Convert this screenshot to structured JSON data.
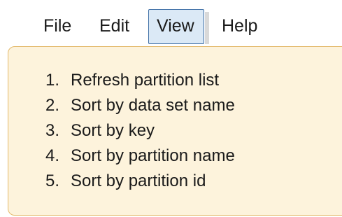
{
  "menubar": {
    "items": [
      {
        "label": "File"
      },
      {
        "label": "Edit"
      },
      {
        "label": "View",
        "active": true
      },
      {
        "label": "Help"
      }
    ]
  },
  "view_menu": {
    "options": [
      {
        "number": "1.",
        "label": "Refresh partition list"
      },
      {
        "number": "2.",
        "label": "Sort by data set name"
      },
      {
        "number": "3.",
        "label": "Sort by key"
      },
      {
        "number": "4.",
        "label": "Sort by partition name"
      },
      {
        "number": "5.",
        "label": "Sort by partition id"
      }
    ]
  },
  "colors": {
    "active_menu_fill": "#dbe9f6",
    "active_menu_border": "#3f6fa6",
    "dropdown_fill": "#fdf3dc",
    "dropdown_border": "#e3b96a"
  }
}
